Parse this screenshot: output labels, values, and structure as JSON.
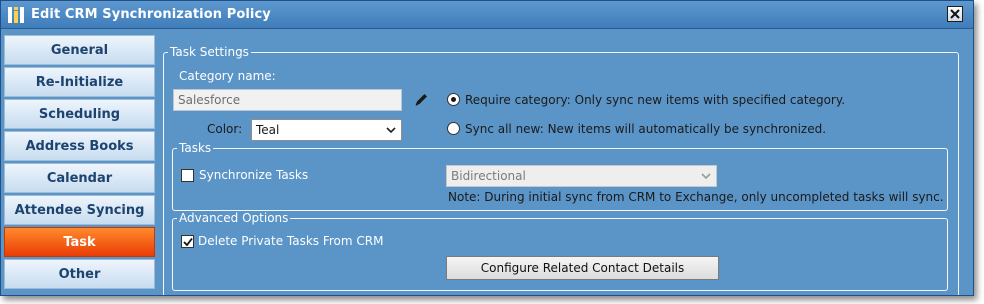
{
  "window": {
    "title": "Edit CRM Synchronization Policy"
  },
  "sidebar": {
    "items": [
      {
        "label": "General",
        "active": false
      },
      {
        "label": "Re-Initialize",
        "active": false
      },
      {
        "label": "Scheduling",
        "active": false
      },
      {
        "label": "Address Books",
        "active": false
      },
      {
        "label": "Calendar",
        "active": false
      },
      {
        "label": "Attendee Syncing",
        "active": false
      },
      {
        "label": "Task",
        "active": true
      },
      {
        "label": "Other",
        "active": false
      }
    ]
  },
  "task_settings": {
    "legend": "Task Settings",
    "category_label": "Category name:",
    "category_value": "Salesforce",
    "color_label": "Color:",
    "color_value": "Teal",
    "radio_require": "Require category: Only sync new items with specified category.",
    "radio_require_checked": true,
    "radio_all": "Sync all new: New items will automatically be synchronized.",
    "radio_all_checked": false
  },
  "tasks": {
    "legend": "Tasks",
    "sync_label": "Synchronize Tasks",
    "sync_checked": false,
    "direction_value": "Bidirectional",
    "note": "Note: During initial sync from CRM to Exchange, only uncompleted tasks will sync."
  },
  "advanced": {
    "legend": "Advanced Options",
    "delete_private_label": "Delete Private Tasks From CRM",
    "delete_private_checked": true,
    "configure_button": "Configure Related Contact Details"
  },
  "icons": {
    "app": "app-logo-icon",
    "close": "close-icon",
    "edit": "pencil-icon",
    "dropdown": "chevron-down-icon",
    "check": "checkmark-icon"
  },
  "colors": {
    "window_bg": "#5b95c8",
    "titlebar": "#4a88c4",
    "active_tab": "#f25a12",
    "tab_text": "#1d4470"
  }
}
